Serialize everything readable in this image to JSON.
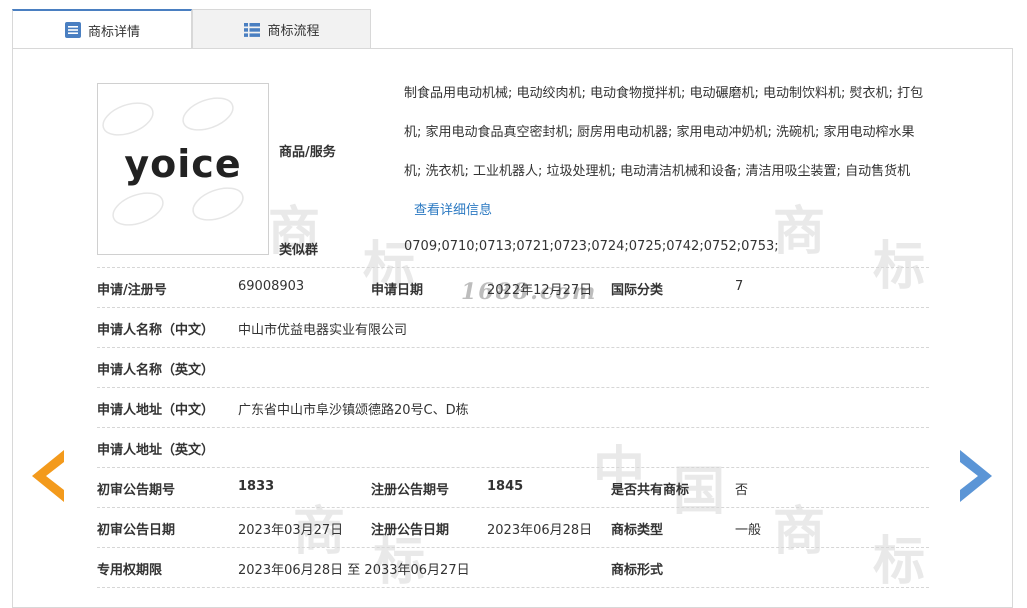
{
  "tabs": [
    {
      "label": "商标详情",
      "icon": "list-icon"
    },
    {
      "label": "商标流程",
      "icon": "grid-icon"
    }
  ],
  "logo": {
    "text": "yoice"
  },
  "goods": {
    "label": "商品/服务",
    "text": "制食品用电动机械; 电动绞肉机; 电动食物搅拌机; 电动碾磨机; 电动制饮料机; 熨衣机; 打包机; 家用电动食品真空密封机; 厨房用电动机器; 家用电动冲奶机; 洗碗机; 家用电动榨水果机; 洗衣机; 工业机器人; 垃圾处理机; 电动清洁机械和设备; 清洁用吸尘装置; 自动售货机",
    "more_link": "查看详细信息"
  },
  "similar_group": {
    "label": "类似群",
    "value": "0709;0710;0713;0721;0723;0724;0725;0742;0752;0753;"
  },
  "reg_no": {
    "label": "申请/注册号",
    "value": "69008903"
  },
  "apply_date": {
    "label": "申请日期",
    "value": "2022年12月27日"
  },
  "intl_class": {
    "label": "国际分类",
    "value": "7"
  },
  "applicant_cn": {
    "label": "申请人名称（中文）",
    "value": "中山市优益电器实业有限公司"
  },
  "applicant_en": {
    "label": "申请人名称（英文）",
    "value": ""
  },
  "address_cn": {
    "label": "申请人地址（中文）",
    "value": "广东省中山市阜沙镇颂德路20号C、D栋"
  },
  "address_en": {
    "label": "申请人地址（英文）",
    "value": ""
  },
  "prelim_issue": {
    "label": "初审公告期号",
    "value": "1833"
  },
  "reg_issue": {
    "label": "注册公告期号",
    "value": "1845"
  },
  "shared": {
    "label": "是否共有商标",
    "value": "否"
  },
  "prelim_date": {
    "label": "初审公告日期",
    "value": "2023年03月27日"
  },
  "reg_date": {
    "label": "注册公告日期",
    "value": "2023年06月28日"
  },
  "tm_type": {
    "label": "商标类型",
    "value": "一般"
  },
  "exclusive": {
    "label": "专用权期限",
    "value": "2023年06月28日 至 2033年06月27日"
  },
  "tm_form": {
    "label": "商标形式",
    "value": ""
  },
  "watermark": {
    "site": "1688.com",
    "chars": [
      "商",
      "标",
      "中",
      "国"
    ]
  },
  "colors": {
    "accent": "#4a7fc1",
    "link": "#2b79c2",
    "prev_arrow": "#f39a1c",
    "next_arrow": "#5b95d6"
  }
}
